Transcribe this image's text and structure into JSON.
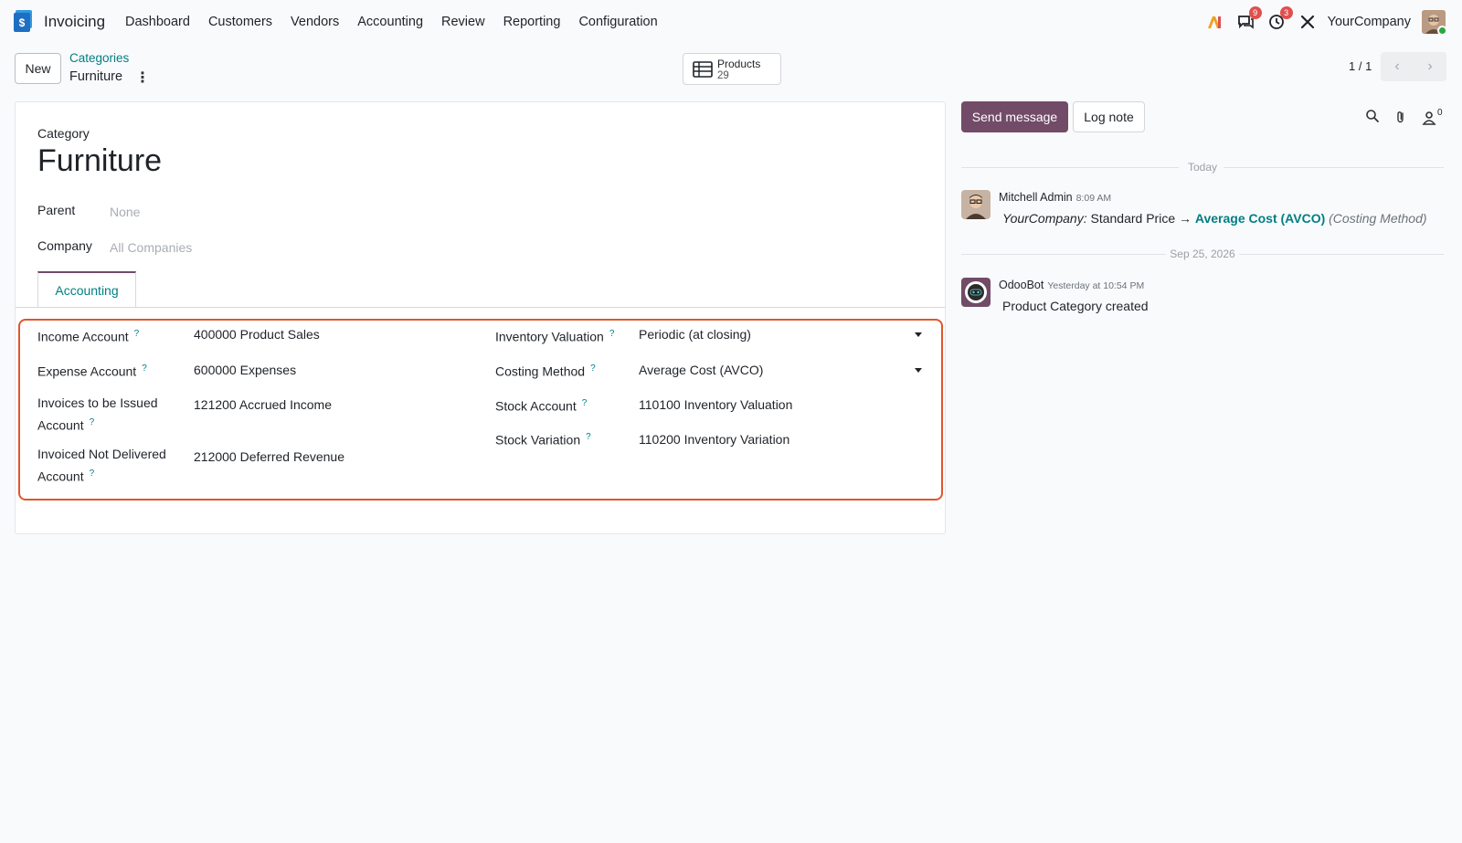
{
  "nav": {
    "app_name": "Invoicing",
    "menu": [
      "Dashboard",
      "Customers",
      "Vendors",
      "Accounting",
      "Review",
      "Reporting",
      "Configuration"
    ],
    "messages_badge": "9",
    "activities_badge": "3",
    "company": "YourCompany"
  },
  "control": {
    "new_label": "New",
    "breadcrumb_parent": "Categories",
    "breadcrumb_current": "Furniture",
    "smart_button": {
      "title": "Products",
      "count": "29"
    },
    "pager": "1 / 1"
  },
  "form": {
    "category_label": "Category",
    "title": "Furniture",
    "parent_label": "Parent",
    "parent_placeholder": "None",
    "company_label": "Company",
    "company_placeholder": "All Companies",
    "tab_label": "Accounting",
    "left_fields": [
      {
        "label": "Income Account",
        "value": "400000 Product Sales"
      },
      {
        "label": "Expense Account",
        "value": "600000 Expenses"
      },
      {
        "label": "Invoices to be Issued Account",
        "value": "121200 Accrued Income"
      },
      {
        "label": "Invoiced Not Delivered Account",
        "value": "212000 Deferred Revenue"
      }
    ],
    "right_fields": [
      {
        "label": "Inventory Valuation",
        "value": "Periodic (at closing)"
      },
      {
        "label": "Costing Method",
        "value": "Average Cost (AVCO)"
      },
      {
        "label": "Stock Account",
        "value": "110100 Inventory Valuation"
      },
      {
        "label": "Stock Variation",
        "value": "110200 Inventory Variation"
      }
    ],
    "help_mark": "?"
  },
  "chatter": {
    "send_message_label": "Send message",
    "log_note_label": "Log note",
    "followers_count": "0",
    "separator_today": "Today",
    "separator_date": "Sep 25, 2026",
    "messages": [
      {
        "author": "Mitchell Admin",
        "time": "8:09 AM",
        "company_prefix": "YourCompany:",
        "old_value": "Standard Price",
        "arrow": "→",
        "new_value": "Average Cost (AVCO)",
        "field_name": "(Costing Method)"
      },
      {
        "author": "OdooBot",
        "time": "Yesterday at 10:54 PM",
        "body": "Product Category created"
      }
    ]
  },
  "colors": {
    "primary": "#714b67",
    "link": "#017e84",
    "highlight_border": "#e0562b",
    "badge": "#e04f4f"
  }
}
